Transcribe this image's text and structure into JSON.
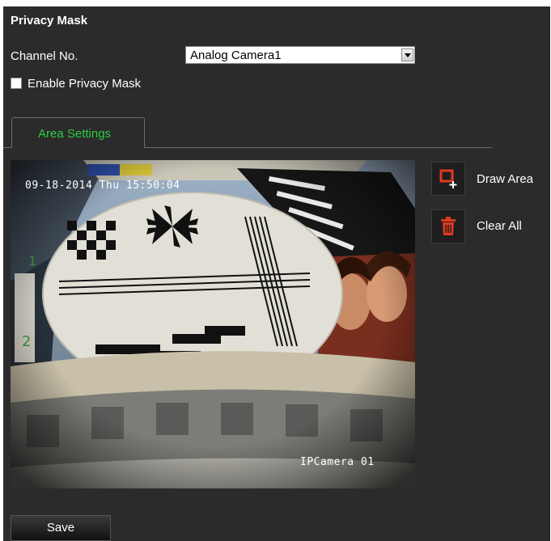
{
  "title": "Privacy Mask",
  "channel": {
    "label": "Channel No.",
    "selected": "Analog Camera1"
  },
  "enable_privacy_mask": {
    "label": "Enable Privacy Mask",
    "checked": false
  },
  "tabs": [
    {
      "label": "Area Settings",
      "active": true
    }
  ],
  "video": {
    "timestamp": "09-18-2014 Thu 15:50:04",
    "camera_name": "IPCamera 01"
  },
  "tools": {
    "draw_area_label": "Draw Area",
    "draw_area_icon": "draw-area-icon",
    "clear_all_label": "Clear All",
    "clear_all_icon": "trash-icon"
  },
  "save_label": "Save",
  "colors": {
    "background": "#2b2b2b",
    "tab_text": "#2ecc40",
    "tool_accent": "#e03a1e"
  }
}
